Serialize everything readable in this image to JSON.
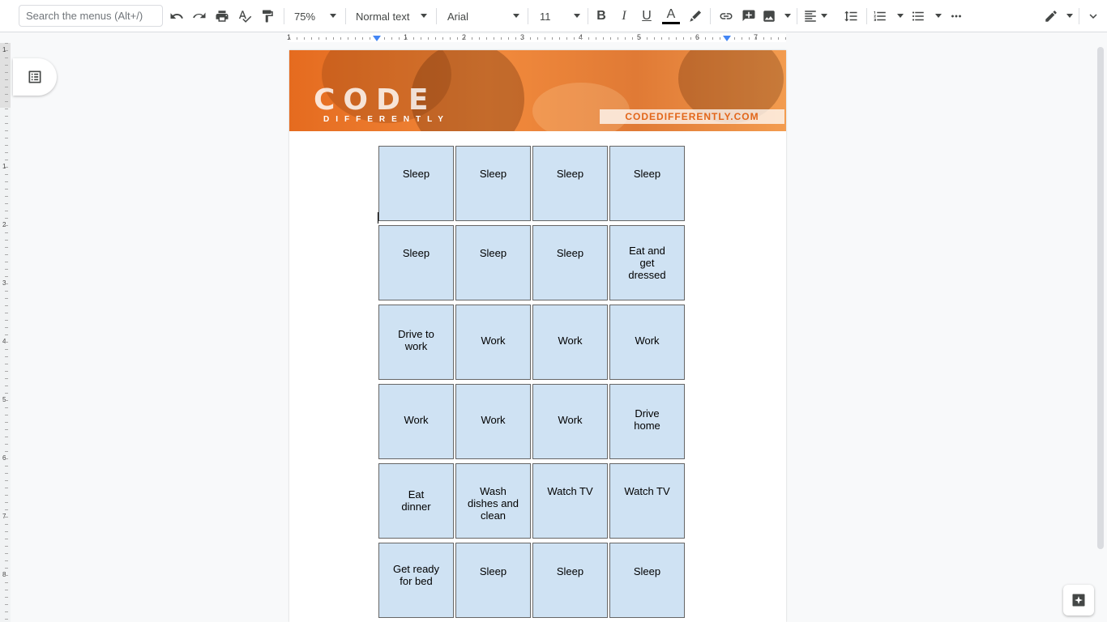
{
  "toolbar": {
    "search_placeholder": "Search the menus (Alt+/)",
    "zoom": "75%",
    "style": "Normal text",
    "font": "Arial",
    "font_size": "11",
    "bold": "B",
    "italic": "I",
    "underline": "U",
    "text_color": "A"
  },
  "ruler": {
    "numbers": [
      "1",
      "1",
      "2",
      "3",
      "4",
      "5",
      "6",
      "7"
    ],
    "vertical_numbers": [
      "1",
      "1",
      "2",
      "3",
      "4",
      "5",
      "6",
      "7",
      "8"
    ]
  },
  "banner": {
    "logo": "CODE",
    "logo_sub": "DIFFERENTLY",
    "url": "CODEDIFFERENTLY.COM"
  },
  "schedule": [
    [
      "Sleep",
      "Sleep",
      "Sleep",
      "Sleep"
    ],
    [
      "Sleep",
      "Sleep",
      "Sleep",
      "Eat and get dressed"
    ],
    [
      "Drive to work",
      "Work",
      "Work",
      "Work"
    ],
    [
      "Work",
      "Work",
      "Work",
      "Drive home"
    ],
    [
      "Eat dinner",
      "Wash dishes and clean",
      "Watch TV",
      "Watch TV"
    ],
    [
      "Get ready for bed",
      "Sleep",
      "Sleep",
      "Sleep"
    ]
  ],
  "colors": {
    "cell_fill": "#cfe2f3",
    "cell_border": "#666666",
    "banner_orange": "#e56b1f"
  }
}
